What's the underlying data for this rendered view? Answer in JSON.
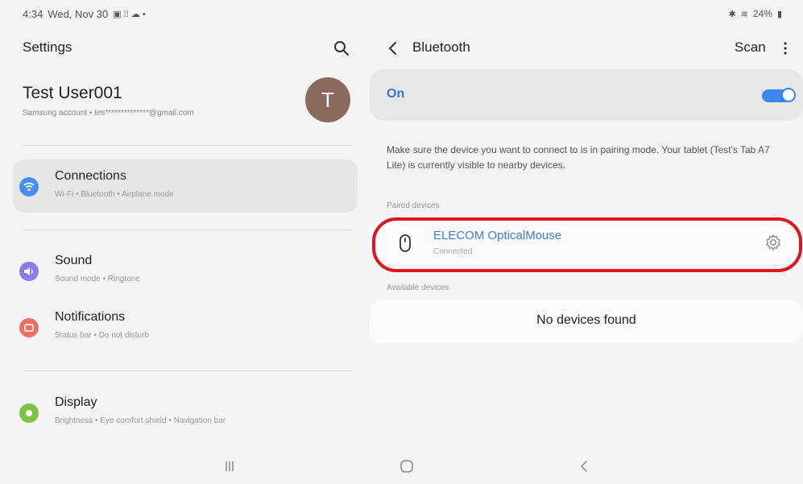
{
  "status_bar": {
    "time": "4:34",
    "date": "Wed, Nov 30",
    "battery": "24%"
  },
  "settings": {
    "title": "Settings",
    "profile": {
      "name": "Test User001",
      "account_line": "Samsung account  •  tes**************@gmail.com",
      "avatar_initial": "T",
      "avatar_color": "#8a6a5e"
    },
    "menu": [
      {
        "label": "Connections",
        "sub": "Wi-Fi  •  Bluetooth  •  Airplane mode",
        "icon": "wifi-icon",
        "color": "#4a8df0",
        "selected": true
      },
      {
        "label": "Sound",
        "sub": "Sound mode  •  Ringtone",
        "icon": "speaker-icon",
        "color": "#8b7ce8",
        "selected": false
      },
      {
        "label": "Notifications",
        "sub": "Status bar  •  Do not disturb",
        "icon": "notification-icon",
        "color": "#f07067",
        "selected": false
      },
      {
        "label": "Display",
        "sub": "Brightness  •  Eye comfort shield  •  Navigation bar",
        "icon": "brightness-icon",
        "color": "#7cc43f",
        "selected": false
      }
    ]
  },
  "bluetooth": {
    "title": "Bluetooth",
    "scan_label": "Scan",
    "toggle_label": "On",
    "toggle_on": true,
    "accent": "#3d85e8",
    "info": "Make sure the device you want to connect to is in pairing mode. Your tablet (Test's Tab A7 Lite) is currently visible to nearby devices.",
    "paired_label": "Paired devices",
    "paired_devices": [
      {
        "name": "ELECOM OpticalMouse",
        "status": "Connected",
        "icon": "mouse-icon"
      }
    ],
    "available_label": "Available devices",
    "no_devices": "No devices found",
    "highlight_color": "#e0141e"
  }
}
